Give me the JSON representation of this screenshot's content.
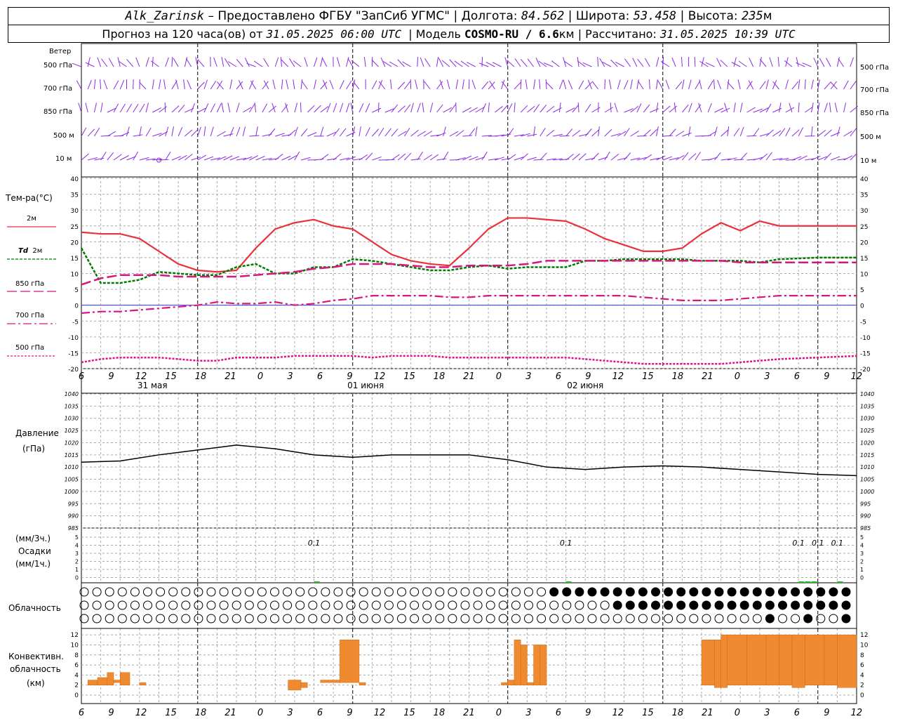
{
  "header": {
    "station": "Alk_Zarinsk",
    "provider": " – Предоставлено ФГБУ \"ЗапСиб УГМС\" | Долгота: ",
    "lon": "84.562",
    "lat_label": " | Широта: ",
    "lat": "53.458",
    "alt_label": " | Высота: ",
    "alt": "235",
    "alt_unit": "м",
    "forecast_prefix": "Прогноз на 120 часа(ов) от ",
    "forecast_start": "31.05.2025 06:00 UTC",
    "model_label": "  | Модель ",
    "model": "COSMO-RU / 6.6",
    "model_unit": "км",
    "calc_label": " | Рассчитано: ",
    "calc_time": "31.05.2025 10:39 UTC"
  },
  "labels": {
    "wind": "Ветер",
    "wind_levels": [
      "500 гПа",
      "700 гПа",
      "850 гПа",
      "500 м",
      "10  м"
    ],
    "temp_title": "Тем-ра(°С)",
    "temp_2m": "2м",
    "td_prefix": "Td",
    "td_2m": "2м",
    "t850": "850 гПа",
    "t700": "700 гПа",
    "t500": "500 гПа",
    "pressure_title": "Давление",
    "pressure_unit": "(гПа)",
    "precip_unit3": "(мм/3ч.)",
    "precip_title": "Осадки",
    "precip_unit1": "(мм/1ч.)",
    "cloud_title": "Облачность",
    "conv_title1": "Конвективн.",
    "conv_title2": "облачность",
    "conv_unit": "(км)"
  },
  "colors": {
    "t2m": "#e8323c",
    "td2m": "#007a00",
    "t850": "#d8167e",
    "t700": "#d8167e",
    "t500": "#e0148a",
    "wind": "#8a2be2",
    "precip": "#22bb22",
    "convective": "#f08a30",
    "pressure": "#000000"
  },
  "chart_data": [
    {
      "type": "line",
      "name": "temperature",
      "x_hours": [
        0,
        3,
        6,
        9,
        12,
        15,
        18,
        21,
        24,
        27,
        30,
        33,
        36,
        39,
        42,
        45,
        48,
        51,
        54,
        57,
        60,
        63,
        66,
        69,
        72,
        75,
        78,
        81,
        84,
        87,
        90,
        93,
        96,
        99,
        102,
        105,
        108,
        114,
        120
      ],
      "x_ticks": [
        "6",
        "9",
        "12",
        "15",
        "18",
        "21",
        "0",
        "3",
        "6",
        "9",
        "12",
        "15",
        "18",
        "21",
        "0",
        "3",
        "6",
        "9",
        "12",
        "15",
        "18",
        "21",
        "0",
        "3",
        "6",
        "9",
        "12"
      ],
      "day_labels": [
        "31 мая",
        "01 июня",
        "02 июня"
      ],
      "ylim": [
        -20,
        40
      ],
      "y_ticks": [
        40,
        35,
        30,
        25,
        20,
        15,
        10,
        5,
        0,
        -5,
        -10,
        -15,
        -20
      ],
      "series": [
        {
          "name": "2м",
          "values": [
            23,
            22.5,
            22.5,
            21,
            17,
            13,
            11,
            10.5,
            11,
            18,
            24,
            26,
            27,
            25,
            24,
            20,
            16,
            14,
            13,
            12.5,
            18,
            24,
            27.5,
            27.5,
            27,
            26.5,
            24,
            21,
            19,
            17,
            17,
            18,
            22.5,
            26,
            23.5,
            26.5,
            25,
            25,
            25
          ]
        },
        {
          "name": "Td 2м",
          "values": [
            18,
            7,
            7,
            8,
            10.5,
            10,
            9.5,
            9.5,
            12,
            13,
            10,
            10,
            12,
            12,
            14.5,
            14,
            13,
            12,
            11,
            11,
            12,
            12.5,
            11.5,
            12,
            12,
            12,
            14,
            14,
            14.5,
            14.5,
            14.5,
            14.5,
            14,
            14,
            14,
            13.5,
            14.5,
            15,
            15
          ]
        },
        {
          "name": "850 гПа",
          "values": [
            6.5,
            8.5,
            9.5,
            9.5,
            9.5,
            9,
            9,
            9,
            9,
            9.5,
            10,
            10.5,
            11.5,
            12,
            13,
            13,
            13,
            12.5,
            12,
            12,
            12.5,
            12.5,
            12.5,
            13,
            14,
            14,
            14,
            14,
            14,
            14,
            14,
            14,
            14,
            14,
            13.5,
            13.5,
            13.5,
            13.5,
            13.5
          ]
        },
        {
          "name": "700 гПа",
          "values": [
            -2.5,
            -2,
            -2,
            -1.5,
            -1,
            -0.5,
            0,
            1,
            0.5,
            0.5,
            1,
            0,
            0.5,
            1.5,
            2,
            3,
            3,
            3,
            3,
            2.5,
            2.5,
            3,
            3,
            3,
            3,
            3,
            3,
            3,
            3,
            2.5,
            2,
            1.5,
            1.5,
            1.5,
            2,
            2.5,
            3,
            3,
            3
          ]
        },
        {
          "name": "500 гПа",
          "values": [
            -18,
            -17,
            -16.5,
            -16.5,
            -16.5,
            -17,
            -17.5,
            -17.5,
            -16.5,
            -16.5,
            -16.5,
            -16,
            -16,
            -16,
            -16,
            -16.5,
            -16,
            -16,
            -16,
            -16.5,
            -16.5,
            -16.5,
            -16.5,
            -16.5,
            -16.5,
            -16.5,
            -17,
            -17.5,
            -18,
            -18.5,
            -18.5,
            -18.5,
            -18.5,
            -18.5,
            -18,
            -17.5,
            -17,
            -16.5,
            -16
          ]
        }
      ]
    },
    {
      "type": "line",
      "name": "pressure",
      "ylim": [
        985,
        1040
      ],
      "y_ticks": [
        1040,
        1035,
        1030,
        1025,
        1020,
        1015,
        1010,
        1005,
        1000,
        995,
        990,
        985
      ],
      "x_hours": [
        0,
        6,
        12,
        18,
        24,
        30,
        36,
        42,
        48,
        54,
        60,
        66,
        72,
        78,
        84,
        90,
        96,
        102,
        108,
        114,
        120
      ],
      "values": [
        1012,
        1012.5,
        1015,
        1017,
        1019,
        1017.5,
        1015,
        1014,
        1015,
        1015,
        1015,
        1013,
        1010,
        1009,
        1010,
        1010.5,
        1010,
        1009,
        1008,
        1007,
        1006.5
      ]
    },
    {
      "type": "bar",
      "name": "precipitation",
      "ylim": [
        0,
        5
      ],
      "y_ticks": [
        5,
        4,
        3,
        2,
        1,
        0,
        5,
        4,
        3,
        2,
        1,
        0
      ],
      "annotations": [
        {
          "x": 36,
          "text": "0.1"
        },
        {
          "x": 75,
          "text": "0.1"
        },
        {
          "x": 111,
          "text": "0.1"
        },
        {
          "x": 114,
          "text": "0.1"
        },
        {
          "x": 117,
          "text": "0.1"
        }
      ],
      "bars": [
        {
          "x": 36,
          "value": 0.1
        },
        {
          "x": 75,
          "value": 0.1
        },
        {
          "x": 111,
          "value": 0.1
        },
        {
          "x": 112,
          "value": 0.1
        },
        {
          "x": 113,
          "value": 0.1
        },
        {
          "x": 117,
          "value": 0.1
        }
      ]
    },
    {
      "type": "table",
      "name": "cloudiness",
      "rows": [
        "high",
        "middle",
        "low"
      ]
    },
    {
      "type": "bar",
      "name": "convective",
      "ylim": [
        0,
        13
      ],
      "y_ticks": [
        12,
        10,
        8,
        6,
        4,
        2,
        0
      ],
      "bars": [
        {
          "x0": 1,
          "x1": 2.5,
          "lo": 2,
          "hi": 3
        },
        {
          "x0": 2.5,
          "x1": 4,
          "lo": 2,
          "hi": 3.5
        },
        {
          "x0": 4,
          "x1": 5,
          "lo": 2,
          "hi": 4.5
        },
        {
          "x0": 5,
          "x1": 6,
          "lo": 2.5,
          "hi": 3
        },
        {
          "x0": 6,
          "x1": 7.5,
          "lo": 2,
          "hi": 4.5
        },
        {
          "x0": 9,
          "x1": 10,
          "lo": 2,
          "hi": 2.5
        },
        {
          "x0": 32,
          "x1": 34,
          "lo": 1,
          "hi": 3
        },
        {
          "x0": 34,
          "x1": 35,
          "lo": 1.5,
          "hi": 2.5
        },
        {
          "x0": 37,
          "x1": 40,
          "lo": 2.5,
          "hi": 3
        },
        {
          "x0": 40,
          "x1": 43,
          "lo": 2.5,
          "hi": 11
        },
        {
          "x0": 43,
          "x1": 44,
          "lo": 2,
          "hi": 2.5
        },
        {
          "x0": 65,
          "x1": 66,
          "lo": 2,
          "hi": 2.5
        },
        {
          "x0": 66,
          "x1": 67,
          "lo": 2,
          "hi": 3
        },
        {
          "x0": 67,
          "x1": 68,
          "lo": 2,
          "hi": 11
        },
        {
          "x0": 68,
          "x1": 69,
          "lo": 2,
          "hi": 10
        },
        {
          "x0": 69,
          "x1": 70,
          "lo": 2,
          "hi": 2.5
        },
        {
          "x0": 70,
          "x1": 71,
          "lo": 2,
          "hi": 10
        },
        {
          "x0": 71,
          "x1": 72,
          "lo": 2,
          "hi": 10
        },
        {
          "x0": 96,
          "x1": 98,
          "lo": 2,
          "hi": 11
        },
        {
          "x0": 98,
          "x1": 99,
          "lo": 1.5,
          "hi": 11
        },
        {
          "x0": 99,
          "x1": 100,
          "lo": 1.5,
          "hi": 12
        },
        {
          "x0": 100,
          "x1": 103,
          "lo": 2,
          "hi": 12
        },
        {
          "x0": 103,
          "x1": 106,
          "lo": 2,
          "hi": 12
        },
        {
          "x0": 106,
          "x1": 108,
          "lo": 2,
          "hi": 12
        },
        {
          "x0": 108,
          "x1": 110,
          "lo": 2,
          "hi": 12
        },
        {
          "x0": 110,
          "x1": 112,
          "lo": 1.5,
          "hi": 12
        },
        {
          "x0": 112,
          "x1": 115,
          "lo": 2,
          "hi": 12
        },
        {
          "x0": 115,
          "x1": 117,
          "lo": 2,
          "hi": 12
        },
        {
          "x0": 117,
          "x1": 120,
          "lo": 1.5,
          "hi": 12
        }
      ]
    }
  ]
}
